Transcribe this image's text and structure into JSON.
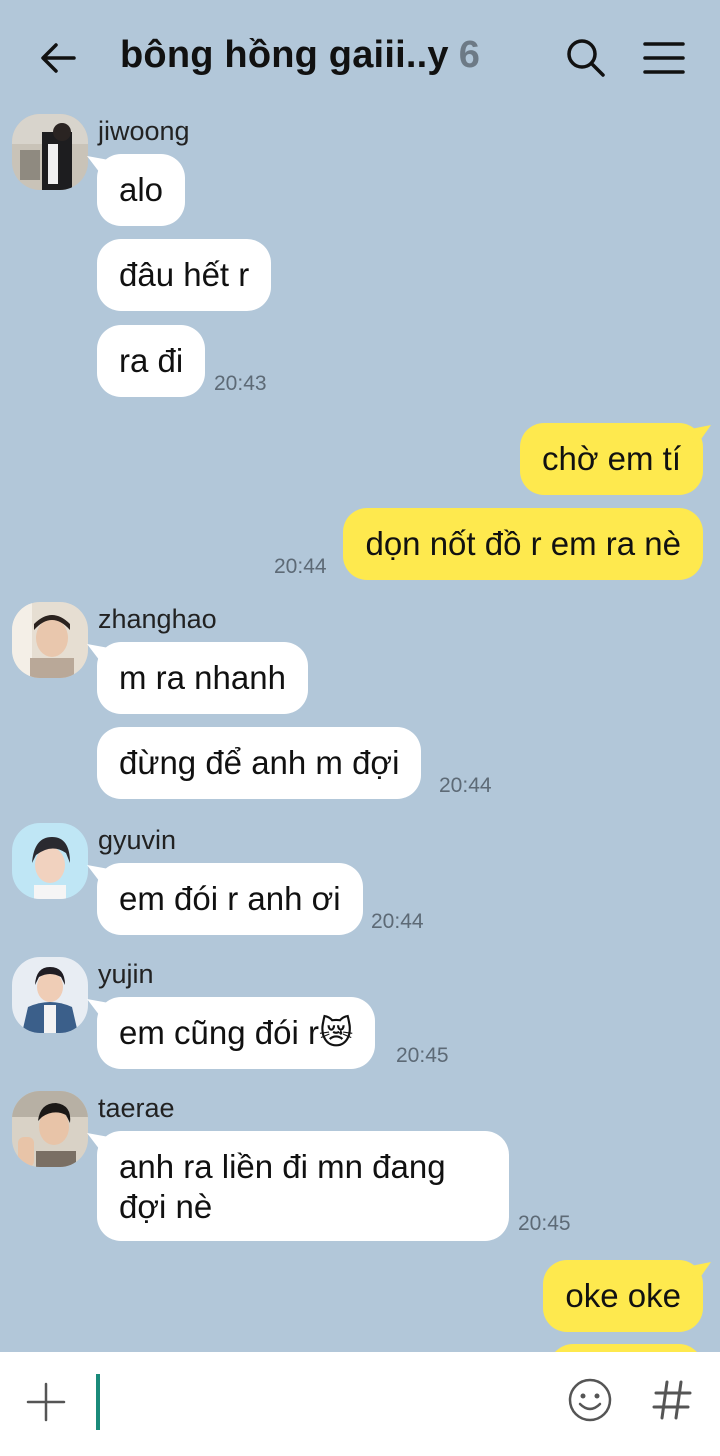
{
  "header": {
    "title": "bông hồng gaiii..y",
    "member_count": "6"
  },
  "messages": [
    {
      "sender": "jiwoong",
      "lines": [
        "alo",
        "đâu hết r",
        "ra đi"
      ],
      "time": "20:43"
    },
    {
      "sender": "me",
      "lines": [
        "chờ em tí",
        "dọn nốt đồ r em ra nè"
      ],
      "time": "20:44"
    },
    {
      "sender": "zhanghao",
      "lines": [
        "m ra nhanh",
        "đừng để anh m đợi"
      ],
      "time": "20:44"
    },
    {
      "sender": "gyuvin",
      "lines": [
        "em đói r anh ơi"
      ],
      "time": "20:44"
    },
    {
      "sender": "yujin",
      "lines": [
        "em cũng đói r😿"
      ],
      "time": "20:45"
    },
    {
      "sender": "taerae",
      "lines": [
        "anh ra liền đi mn đang đợi nè"
      ],
      "time": "20:45"
    },
    {
      "sender": "me",
      "lines": [
        "oke oke"
      ],
      "time": ""
    }
  ],
  "input": {
    "value": ""
  },
  "icons": {
    "back": "arrow-left-icon",
    "search": "search-icon",
    "menu": "hamburger-menu-icon",
    "plus": "plus-icon",
    "emoji": "smiley-icon",
    "hash": "hashtag-icon"
  },
  "colors": {
    "background": "#b2c7d9",
    "my_bubble": "#fee94e",
    "their_bubble": "#ffffff",
    "cursor": "#1a8a7a"
  }
}
